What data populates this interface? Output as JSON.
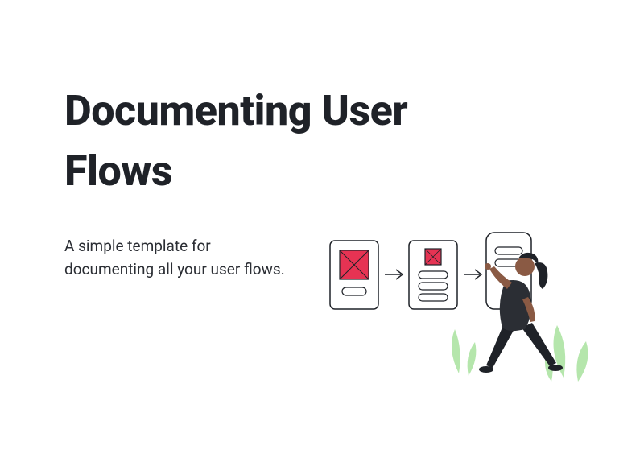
{
  "title": "Documenting User Flows",
  "subtitle": "A simple template for documenting all your user flows.",
  "illustration": {
    "accent": "#e63353",
    "stroke": "#1f2228",
    "plant": "#b5e6ac",
    "skin": "#8a5a44",
    "hair": "#1f2228",
    "top": "#2b2e34",
    "pants": "#1f2228"
  }
}
